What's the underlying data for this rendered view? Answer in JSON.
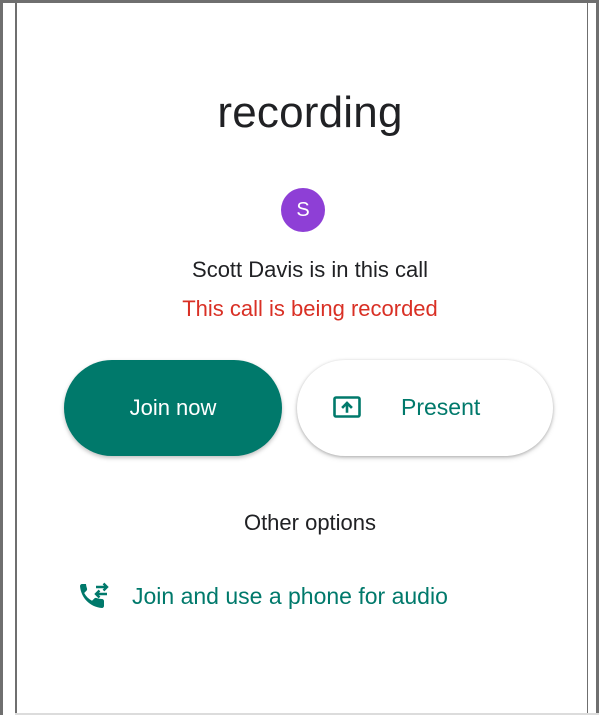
{
  "title": "recording",
  "avatar": {
    "initial": "S",
    "color": "#8e3fd6"
  },
  "participants_text": "Scott Davis is in this call",
  "recording_notice": "This call is being recorded",
  "buttons": {
    "join_label": "Join now",
    "present_label": "Present"
  },
  "other_options_label": "Other options",
  "phone_audio_label": "Join and use a phone for audio",
  "colors": {
    "accent": "#00796b",
    "recording_red": "#d93025",
    "avatar_purple": "#8e3fd6"
  },
  "icons": {
    "present": "present-screen-icon",
    "phone": "phone-forwarded-icon"
  }
}
